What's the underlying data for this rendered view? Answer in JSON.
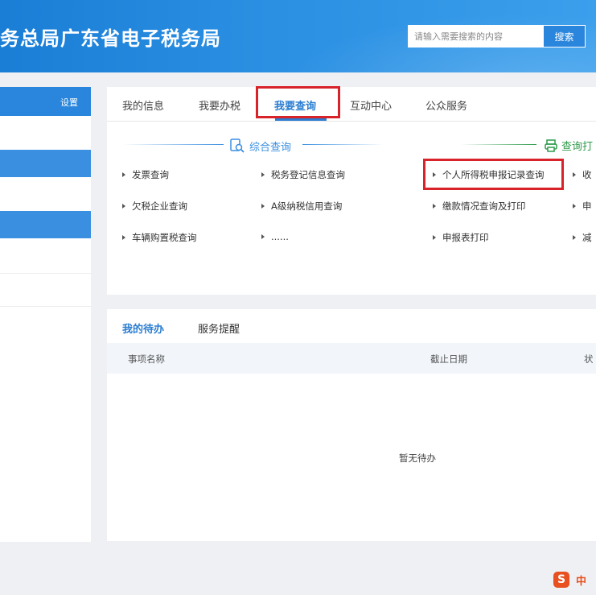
{
  "header": {
    "title": "务总局广东省电子税务局",
    "search_placeholder": "请输入需要搜索的内容",
    "search_button": "搜索"
  },
  "sidebar": {
    "settings": "设置"
  },
  "tabs": [
    {
      "label": "我的信息"
    },
    {
      "label": "我要办税"
    },
    {
      "label": "我要查询",
      "active": true
    },
    {
      "label": "互动中心"
    },
    {
      "label": "公众服务"
    }
  ],
  "sections": {
    "general_query": "综合查询",
    "query_print": "查询打"
  },
  "query_links": [
    "发票查询",
    "税务登记信息查询",
    "个人所得税申报记录查询",
    "收",
    "欠税企业查询",
    "A级纳税信用查询",
    "缴款情况查询及打印",
    "申",
    "车辆购置税查询",
    "......",
    "申报表打印",
    "减"
  ],
  "todo": {
    "tabs": [
      "我的待办",
      "服务提醒"
    ],
    "columns": [
      "事项名称",
      "截止日期",
      "状"
    ],
    "empty_text": "暂无待办"
  },
  "ime": {
    "logo": "S",
    "lang": "中"
  },
  "colors": {
    "header_blue": "#1a7ed6",
    "accent_blue": "#2a7dd1",
    "highlight_red": "#d8232a",
    "section_green": "#2e9b4a"
  }
}
